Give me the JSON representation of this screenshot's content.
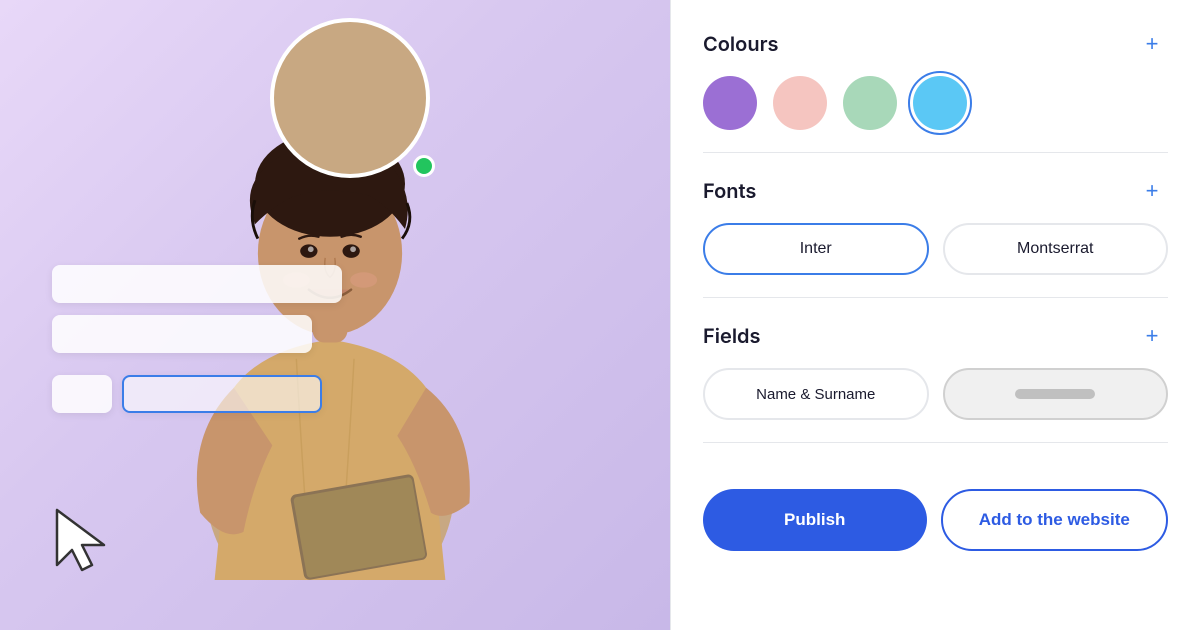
{
  "left": {
    "alt": "Person sitting with book"
  },
  "right": {
    "colours_section": {
      "title": "Colours",
      "add_label": "+",
      "swatches": [
        {
          "color": "#9b6fd4",
          "label": "purple",
          "selected": false
        },
        {
          "color": "#f5c5c0",
          "label": "pink",
          "selected": false
        },
        {
          "color": "#a8d8b9",
          "label": "mint",
          "selected": false
        },
        {
          "color": "#5bc8f5",
          "label": "cyan",
          "selected": true
        }
      ]
    },
    "fonts_section": {
      "title": "Fonts",
      "add_label": "+",
      "fonts": [
        {
          "label": "Inter",
          "selected": true
        },
        {
          "label": "Montserrat",
          "selected": false
        }
      ]
    },
    "fields_section": {
      "title": "Fields",
      "add_label": "+",
      "fields": [
        {
          "label": "Name & Surname",
          "filled": false
        },
        {
          "label": "",
          "filled": true
        }
      ]
    },
    "actions": {
      "publish_label": "Publish",
      "add_website_label": "Add to the website"
    }
  }
}
